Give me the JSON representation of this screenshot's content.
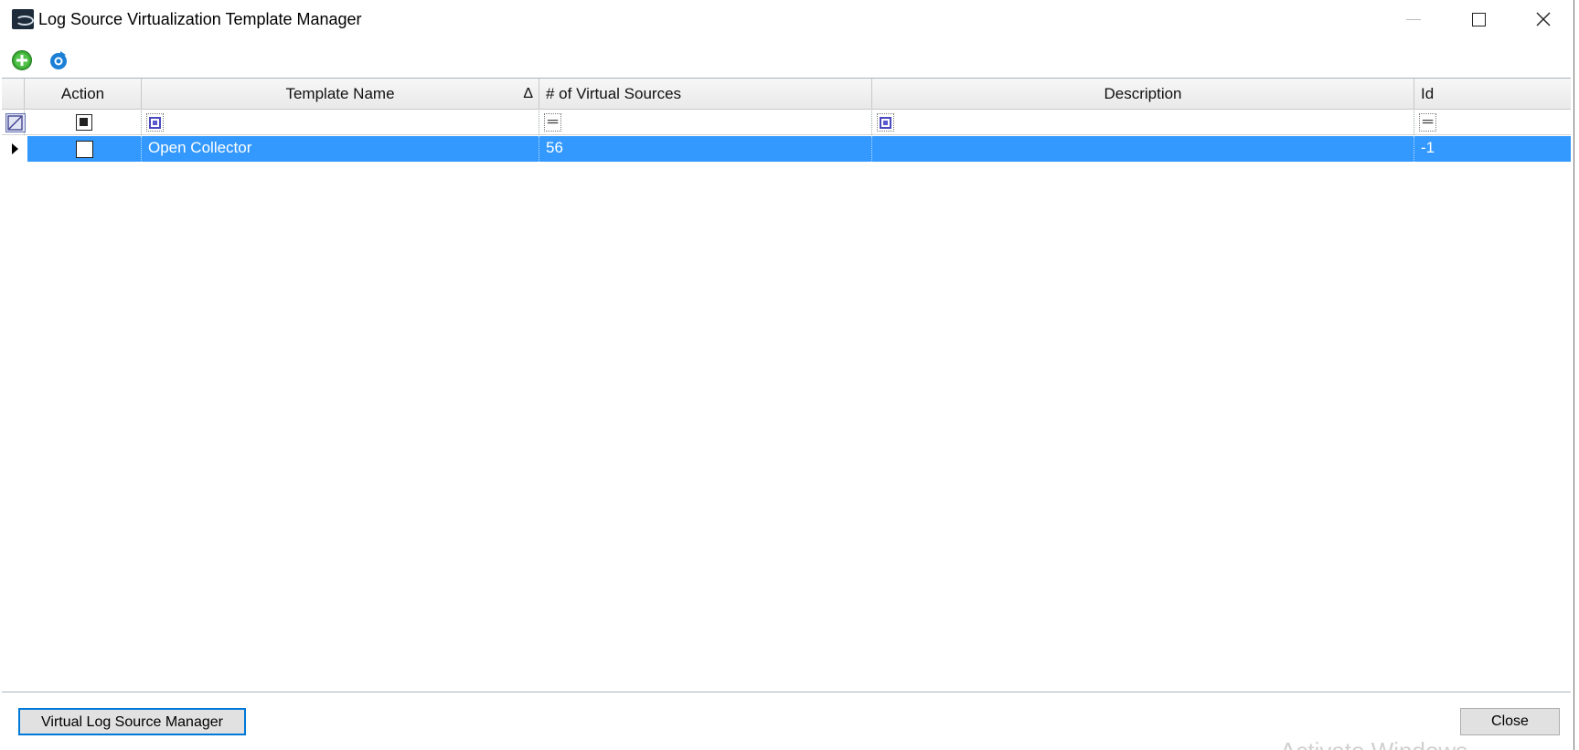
{
  "window": {
    "title": "Log Source Virtualization Template Manager",
    "icon": "netmon-app-icon",
    "controls": [
      "minimize",
      "maximize",
      "close"
    ]
  },
  "toolbar": {
    "buttons": [
      {
        "name": "add-icon",
        "color": "#2e9f2e"
      },
      {
        "name": "refresh-icon",
        "color": "#1b7fd6"
      }
    ]
  },
  "grid": {
    "columns": [
      {
        "label": "Action"
      },
      {
        "label": "Template Name",
        "sort": "ascending"
      },
      {
        "label": "# of Virtual Sources"
      },
      {
        "label": "Description"
      },
      {
        "label": "Id"
      }
    ],
    "filter_ops": {
      "template_name": "contains",
      "virtual_sources": "=",
      "description": "contains",
      "id": "="
    },
    "rows": [
      {
        "action_checked": false,
        "template_name": "Open Collector",
        "virtual_sources": "56",
        "description": "",
        "id": "-1",
        "selected": true
      }
    ],
    "selection_color": "#3399ff"
  },
  "footer": {
    "virtual_log_source_manager_label": "Virtual Log Source Manager",
    "close_label": "Close"
  },
  "watermark": "Activate Windows"
}
